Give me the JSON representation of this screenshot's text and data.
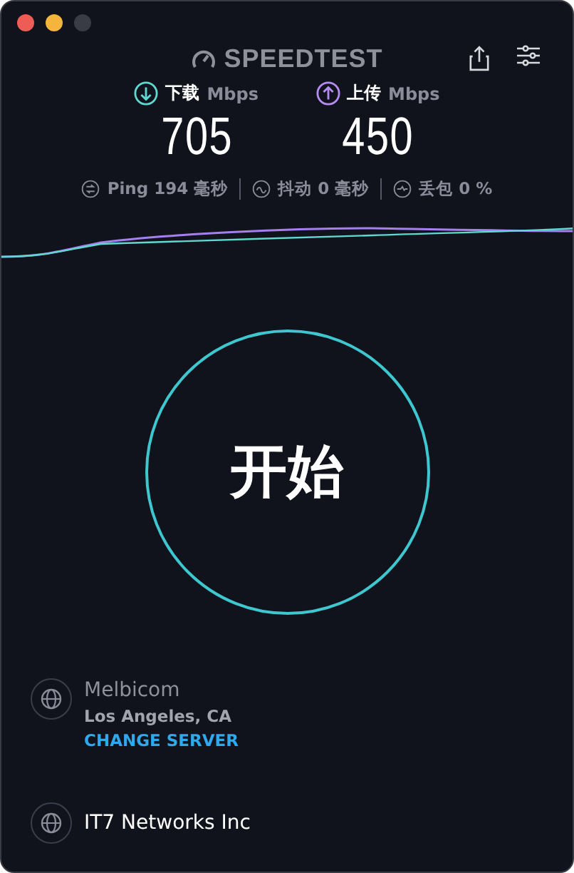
{
  "header": {
    "logo": "SPEEDTEST"
  },
  "speeds": [
    {
      "kind": "download",
      "label": "下载",
      "unit": "Mbps",
      "value": "705"
    },
    {
      "kind": "upload",
      "label": "上传",
      "unit": "Mbps",
      "value": "450"
    }
  ],
  "stats": [
    {
      "kind": "ping",
      "text": "Ping 194 毫秒"
    },
    {
      "kind": "jitter",
      "text": "抖动 0 毫秒"
    },
    {
      "kind": "loss",
      "text": "丢包 0 %"
    }
  ],
  "start_button": "开始",
  "server": {
    "provider": "Melbicom",
    "location": "Los Angeles, CA",
    "change": "CHANGE SERVER"
  },
  "isp": {
    "name": "IT7 Networks Inc"
  }
}
